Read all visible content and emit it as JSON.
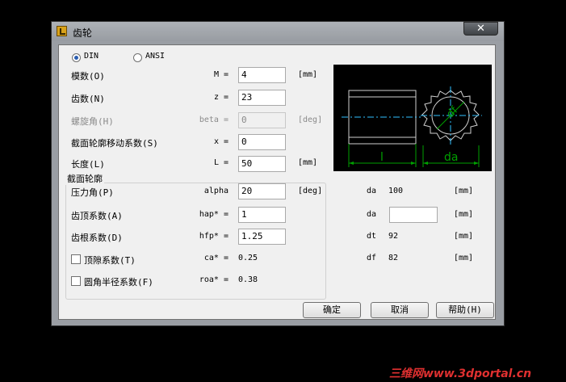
{
  "window": {
    "title": "齿轮",
    "close_symbol": "✕"
  },
  "standard": {
    "din_label": "DIN",
    "ansi_label": "ANSI",
    "selected": "DIN"
  },
  "params": {
    "module": {
      "label": "模数(O)",
      "symbol": "M =",
      "value": "4",
      "unit": "[mm]"
    },
    "teeth": {
      "label": "齿数(N)",
      "symbol": "z =",
      "value": "23"
    },
    "helix": {
      "label": "螺旋角(H)",
      "symbol": "beta =",
      "value": "0",
      "unit": "[deg]"
    },
    "profile_shift": {
      "label": "截面轮廓移动系数(S)",
      "symbol": "x =",
      "value": "0"
    },
    "length": {
      "label": "长度(L)",
      "symbol": "L =",
      "value": "50",
      "unit": "[mm]"
    }
  },
  "profile": {
    "group_title": "截面轮廓",
    "pressure_angle": {
      "label": "压力角(P)",
      "symbol": "alpha",
      "value": "20",
      "unit": "[deg]"
    },
    "addendum": {
      "label": "齿顶系数(A)",
      "symbol": "hap* =",
      "value": "1"
    },
    "dedendum": {
      "label": "齿根系数(D)",
      "symbol": "hfp* =",
      "value": "1.25"
    },
    "clearance": {
      "label": "顶隙系数(T)",
      "symbol": "ca* =",
      "value": "0.25",
      "checked": false
    },
    "root_radius": {
      "label": "圆角半径系数(F)",
      "symbol": "roa* =",
      "value": "0.38",
      "checked": false
    }
  },
  "results": {
    "da1": {
      "label": "da",
      "value": "100",
      "unit": "[mm]"
    },
    "da2": {
      "label": "da",
      "value": "",
      "unit": "[mm]"
    },
    "dt": {
      "label": "dt",
      "value": "92",
      "unit": "[mm]"
    },
    "df": {
      "label": "df",
      "value": "82",
      "unit": "[mm]"
    }
  },
  "diagram": {
    "length_label": "l",
    "diameter_label": "da",
    "df_label": "df"
  },
  "buttons": {
    "ok": "确定",
    "cancel": "取消",
    "help": "帮助(H)"
  },
  "watermark": "三维网www.3dportal.cn",
  "colors": {
    "accent": "#2a5db0",
    "diagram_line": "#00a000",
    "diagram_center": "#30c0ff"
  }
}
